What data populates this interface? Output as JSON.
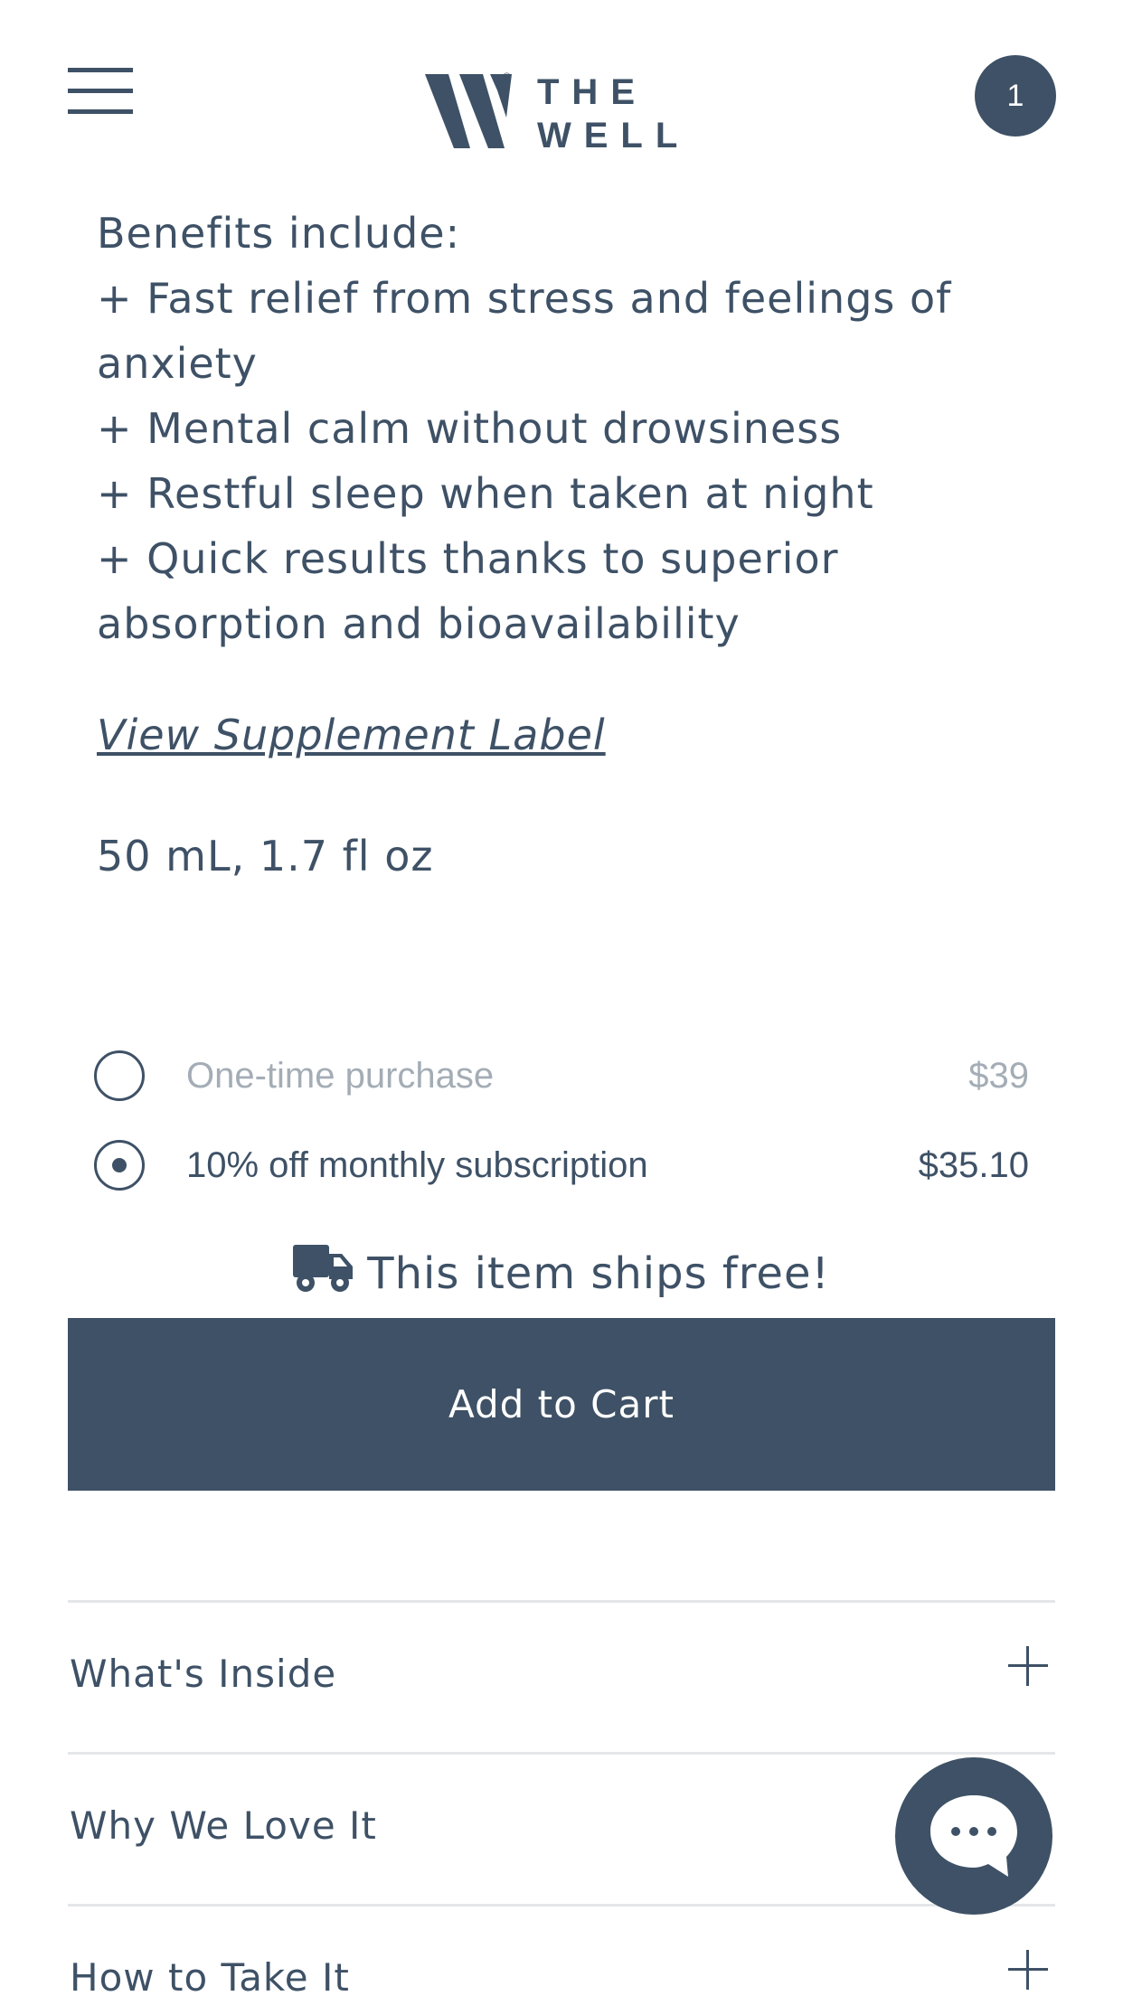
{
  "header": {
    "menu_icon": "hamburger-menu-icon",
    "logo_line1": "THE",
    "logo_line2": "WELL",
    "logo_registered": "®",
    "cart_count": "1"
  },
  "benefits": {
    "heading": "Benefits include:",
    "items": [
      "+ Fast relief from stress and feelings of anxiety",
      "+ Mental calm without drowsiness",
      "+ Restful sleep when taken at night",
      "+ Quick results thanks to superior absorption and bioavailability"
    ]
  },
  "supplement_link": "View Supplement Label",
  "size": "50 mL, 1.7 fl oz",
  "purchase_options": [
    {
      "label": "One-time purchase",
      "price": "$39",
      "selected": false
    },
    {
      "label": "10% off monthly subscription",
      "price": "$35.10",
      "selected": true
    }
  ],
  "shipping": {
    "icon": "truck-icon",
    "text": "This item ships free!"
  },
  "add_to_cart": "Add to Cart",
  "accordion": [
    {
      "label": "What's Inside"
    },
    {
      "label": "Why We Love It"
    },
    {
      "label": "How to Take It"
    }
  ],
  "chat": {
    "icon": "chat-bubble-icon"
  },
  "colors": {
    "primary": "#3e5166",
    "muted": "#a4adb6",
    "divider": "#e4e6e9",
    "background": "#ffffff"
  }
}
